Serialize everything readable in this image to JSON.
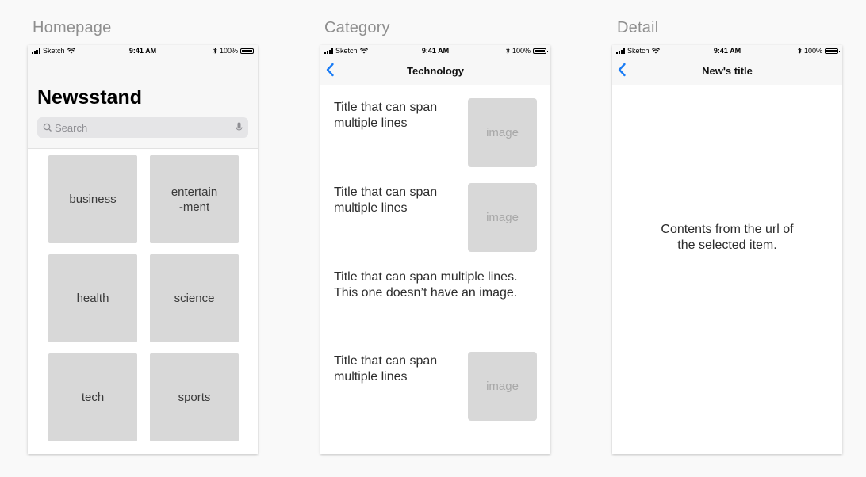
{
  "artboards": {
    "homepage_label": "Homepage",
    "category_label": "Category",
    "detail_label": "Detail"
  },
  "statusbar": {
    "carrier": "Sketch",
    "time": "9:41 AM",
    "battery": "100%"
  },
  "homepage": {
    "title": "Newsstand",
    "search_placeholder": "Search",
    "tiles": [
      {
        "label": "business"
      },
      {
        "label": "entertain\n-ment"
      },
      {
        "label": "health"
      },
      {
        "label": "science"
      },
      {
        "label": "tech"
      },
      {
        "label": "sports"
      }
    ]
  },
  "category": {
    "nav_title": "Technology",
    "items": [
      {
        "title": "Title that can span multiple lines",
        "image_label": "image"
      },
      {
        "title": "Title that can span multiple lines",
        "image_label": "image"
      },
      {
        "title": "Title that can span multiple lines. This one doesn’t have an image."
      },
      {
        "title": "Title that can span multiple lines",
        "image_label": "image"
      }
    ]
  },
  "detail": {
    "nav_title": "New's title",
    "content": "Contents from the url of the selected item."
  },
  "colors": {
    "accent": "#1a7cf5",
    "tile": "#d8d8d8",
    "navbar": "#f7f7f7"
  }
}
